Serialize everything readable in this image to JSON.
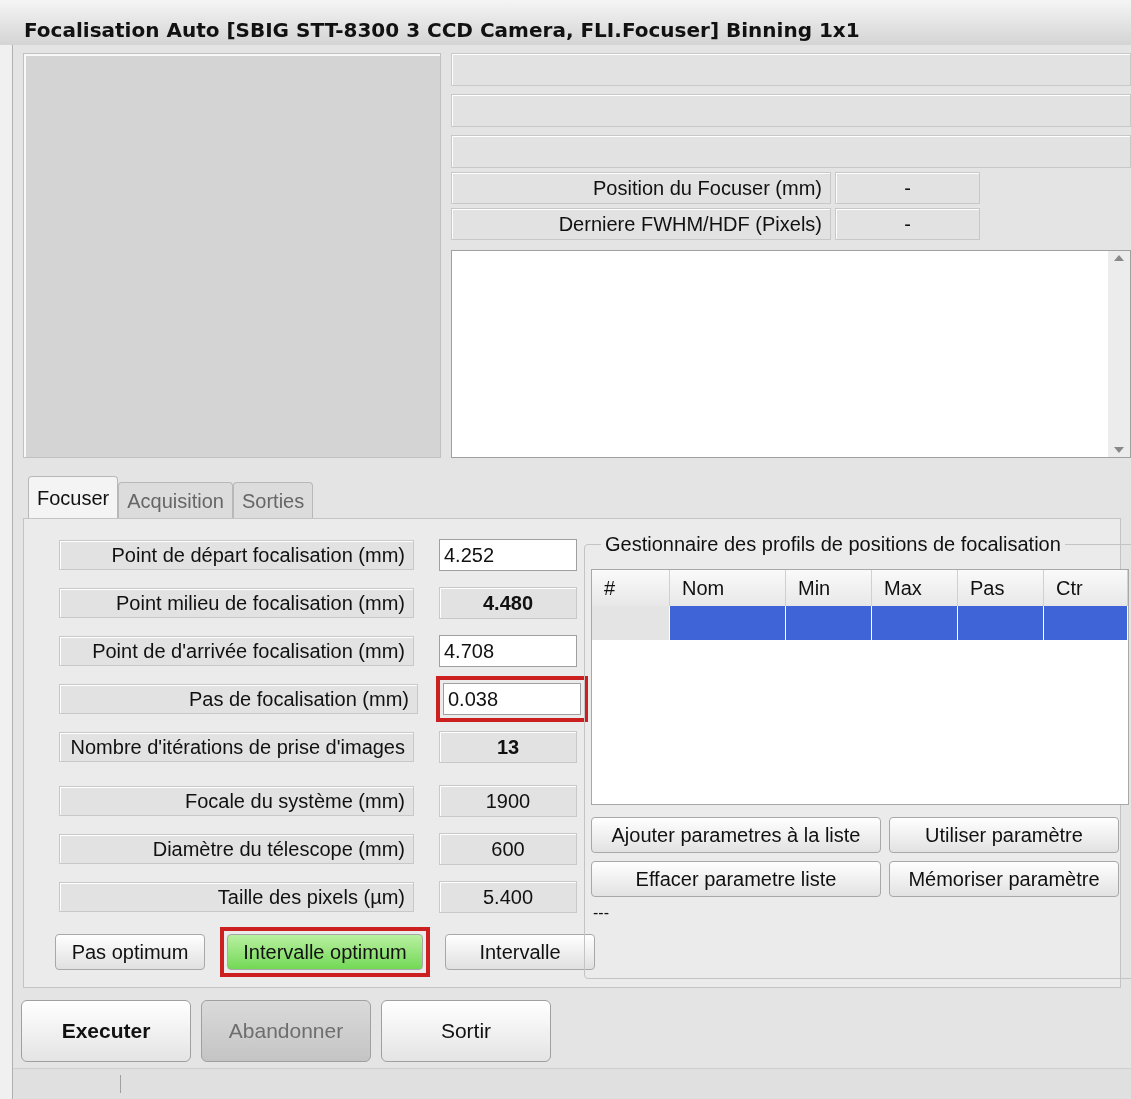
{
  "window": {
    "title": "Focalisation Auto [SBIG STT-8300 3 CCD Camera, FLI.Focuser] Binning 1x1"
  },
  "info_rows": [
    {
      "label": "Position du Focuser  (mm)",
      "value": "-"
    },
    {
      "label": "Derniere FWHM/HDF  (Pixels)",
      "value": "-"
    }
  ],
  "tabs": [
    {
      "label": "Focuser",
      "selected": true
    },
    {
      "label": "Acquisition",
      "selected": false
    },
    {
      "label": "Sorties",
      "selected": false
    }
  ],
  "parameter_groups": [
    [
      {
        "label": "Point de départ focalisation (mm)",
        "value": "4.252",
        "kind": "input",
        "highlighted": false
      },
      {
        "label": "Point milieu de focalisation (mm)",
        "value": "4.480",
        "kind": "computed",
        "highlighted": false
      },
      {
        "label": "Point de d'arrivée focalisation (mm)",
        "value": "4.708",
        "kind": "input",
        "highlighted": false
      },
      {
        "label": "Pas de focalisation (mm)",
        "value": "0.038",
        "kind": "input",
        "highlighted": true
      },
      {
        "label": "Nombre d'itérations de prise d'images",
        "value": "13",
        "kind": "computed",
        "highlighted": false
      }
    ],
    [
      {
        "label": "Focale du système (mm)",
        "value": "1900",
        "kind": "constant",
        "highlighted": false
      },
      {
        "label": "Diamètre du télescope (mm)",
        "value": "600",
        "kind": "constant",
        "highlighted": false
      },
      {
        "label": "Taille des pixels (µm)",
        "value": "5.400",
        "kind": "constant",
        "highlighted": false
      }
    ]
  ],
  "mode_buttons": [
    {
      "label": "Pas optimum",
      "selected": false,
      "highlighted": false
    },
    {
      "label": "Intervalle optimum",
      "selected": true,
      "highlighted": true
    },
    {
      "label": "Intervalle",
      "selected": false,
      "highlighted": false
    }
  ],
  "profiles": {
    "title": "Gestionnaire des profils de positions de focalisation",
    "columns": [
      "#",
      "Nom",
      "Min",
      "Max",
      "Pas",
      "Ctr"
    ],
    "rows": [
      {
        "selected": true
      }
    ],
    "buttons": [
      "Ajouter parametres à la liste",
      "Utiliser paramètre",
      "Effacer parametre liste",
      "Mémoriser paramètre"
    ],
    "status": "---"
  },
  "actions": [
    {
      "label": "Executer",
      "disabled": false,
      "bold": true
    },
    {
      "label": "Abandonner",
      "disabled": true,
      "bold": false
    },
    {
      "label": "Sortir",
      "disabled": false,
      "bold": false
    }
  ]
}
